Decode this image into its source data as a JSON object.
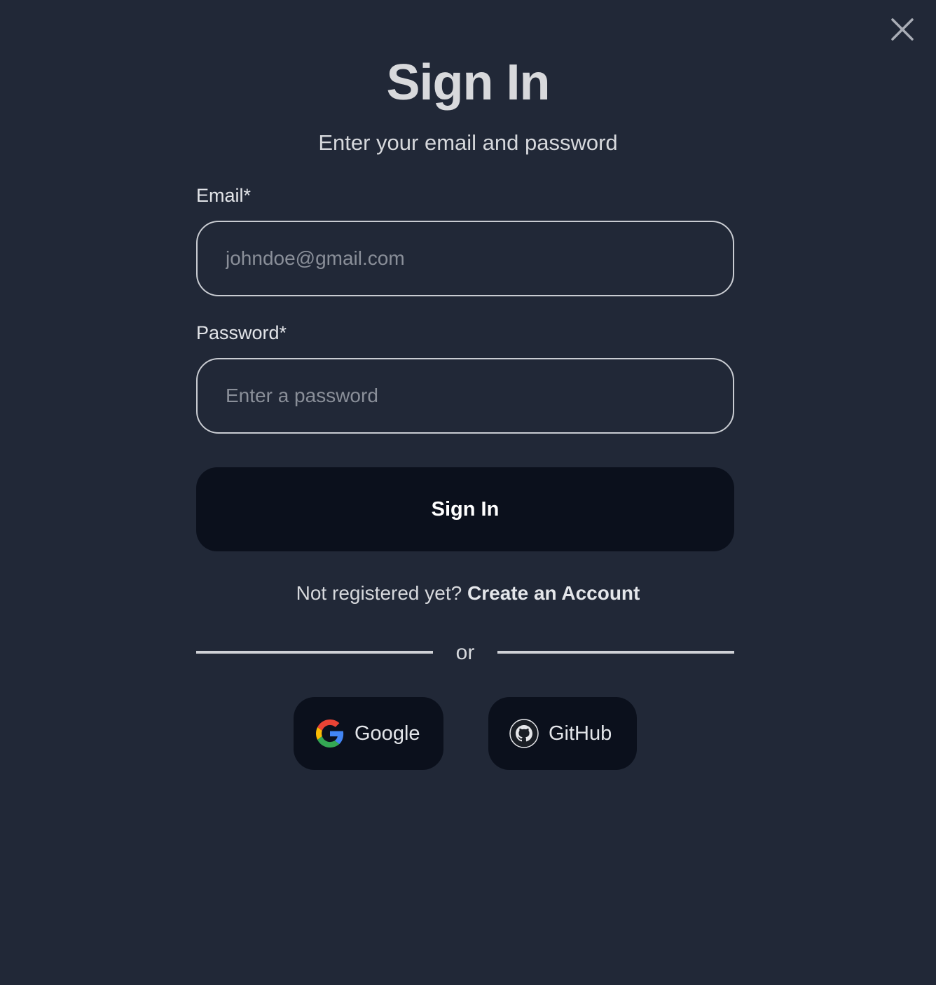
{
  "header": {
    "title": "Sign In",
    "subtitle": "Enter your email and password",
    "close_icon": "close-icon"
  },
  "form": {
    "email": {
      "label": "Email*",
      "placeholder": "johndoe@gmail.com",
      "value": ""
    },
    "password": {
      "label": "Password*",
      "placeholder": "Enter a password",
      "value": ""
    },
    "submit_label": "Sign In"
  },
  "register": {
    "prompt": "Not registered yet?",
    "link_label": "Create an Account"
  },
  "divider": {
    "text": "or"
  },
  "social": [
    {
      "label": "Google",
      "icon": "google-icon"
    },
    {
      "label": "GitHub",
      "icon": "github-icon"
    }
  ],
  "colors": {
    "background": "#212837",
    "button": "#0b101c",
    "text": "#d7d9de",
    "border": "#c9ccd2"
  }
}
